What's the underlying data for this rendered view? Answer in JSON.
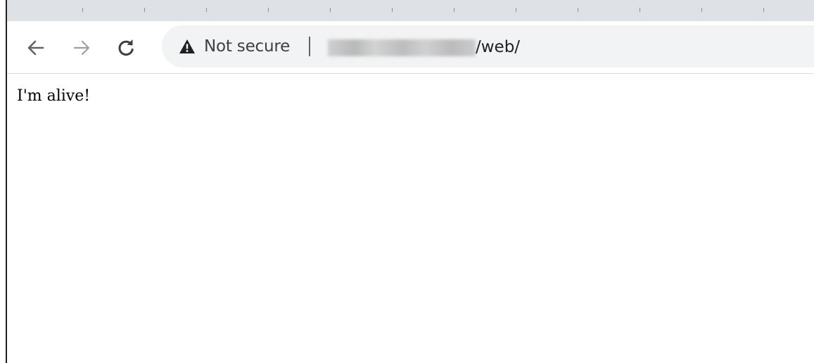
{
  "browser": {
    "toolbar": {
      "back_icon": "arrow-left-icon",
      "forward_icon": "arrow-right-icon",
      "reload_icon": "reload-icon"
    },
    "address_bar": {
      "security_icon": "warning-triangle-icon",
      "security_label": "Not secure",
      "url_path": "/web/"
    }
  },
  "page": {
    "body_text": "I'm alive!"
  },
  "colors": {
    "tab_strip_bg": "#dee1e6",
    "omnibox_bg": "#f1f3f4",
    "icon_color": "#5f6368",
    "text_color": "#202124"
  }
}
